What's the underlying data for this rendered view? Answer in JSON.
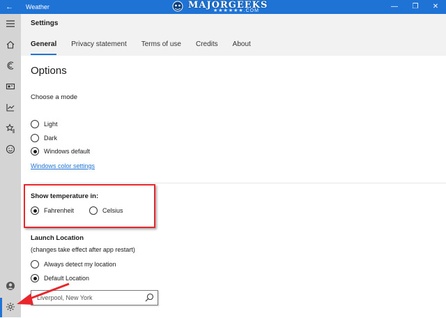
{
  "window": {
    "back_glyph": "←",
    "app_title": "Weather",
    "watermark_text": "MAJORGEEKS",
    "watermark_sub": "★★★★★★.COM",
    "minimize_glyph": "—",
    "restore_glyph": "❐",
    "close_glyph": "✕"
  },
  "sidebar": {
    "items": [
      {
        "icon": "hamburger-menu-icon"
      },
      {
        "icon": "home-icon"
      },
      {
        "icon": "forecast-icon"
      },
      {
        "icon": "maps-icon"
      },
      {
        "icon": "historical-weather-icon"
      },
      {
        "icon": "favorites-icon"
      },
      {
        "icon": "news-icon"
      },
      {
        "icon": "account-icon"
      },
      {
        "icon": "settings-gear-icon",
        "selected": true
      }
    ]
  },
  "header": {
    "title": "Settings",
    "tabs": [
      {
        "label": "General",
        "active": true
      },
      {
        "label": "Privacy statement"
      },
      {
        "label": "Terms of use"
      },
      {
        "label": "Credits"
      },
      {
        "label": "About"
      }
    ]
  },
  "options": {
    "heading": "Options",
    "mode_label": "Choose a mode",
    "modes": [
      {
        "label": "Light",
        "selected": false
      },
      {
        "label": "Dark",
        "selected": false
      },
      {
        "label": "Windows default",
        "selected": true
      }
    ],
    "color_link": "Windows color settings"
  },
  "temperature": {
    "label": "Show temperature in:",
    "units": [
      {
        "label": "Fahrenheit",
        "selected": true
      },
      {
        "label": "Celsius",
        "selected": false
      }
    ]
  },
  "launch": {
    "label": "Launch Location",
    "note": "(changes take effect after app restart)",
    "options": [
      {
        "label": "Always detect my location",
        "selected": false
      },
      {
        "label": "Default Location",
        "selected": true
      }
    ],
    "location_value": "Liverpool, New York"
  },
  "colors": {
    "accent": "#1e73d4",
    "annotation_red": "#e8262b",
    "sidebar_bg": "#d4d4d4",
    "header_bg": "#f2f2f2"
  }
}
